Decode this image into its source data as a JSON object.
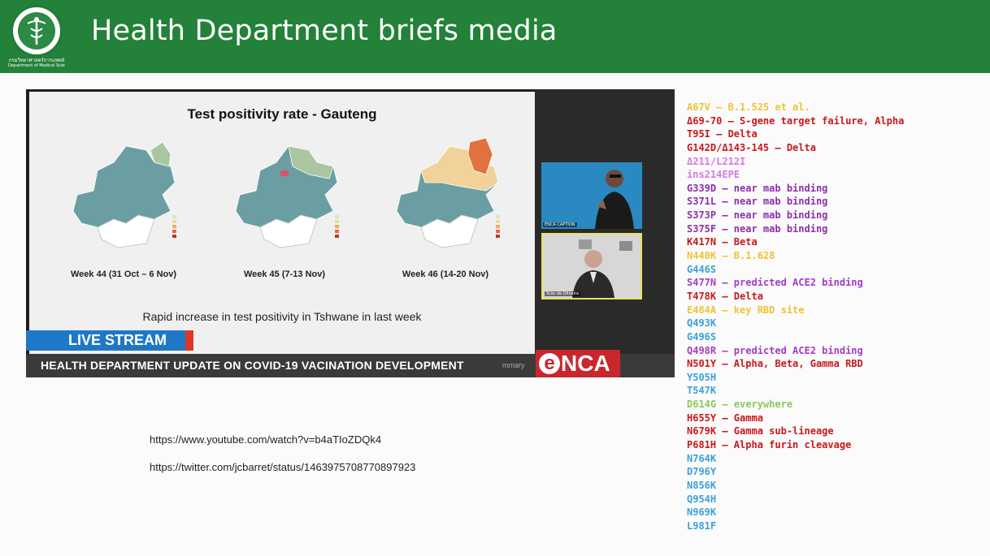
{
  "header": {
    "title": "Health Department briefs media",
    "logo_line1": "กรมวิทยาศาสตร์การแพทย์",
    "logo_line2": "Department of Medical Sciences",
    "bg_color": "#238139"
  },
  "slide": {
    "title": "Test positivity rate - Gauteng",
    "weeks": [
      "Week 44 (31 Oct – 6 Nov)",
      "Week 45 (7-13 Nov)",
      "Week 46 (14-20 Nov)"
    ],
    "caption": "Rapid increase in test positivity in Tshwane in last week"
  },
  "broadcast": {
    "live_label": "LIVE STREAM",
    "ticker": "HEALTH DEPARTMENT UPDATE ON COVID-19 VACINATION DEVELOPMENT",
    "ticker_extra": "mmary",
    "channel_e": "e",
    "channel_rest": "NCA",
    "cam1_label": "ENCA CAPTION",
    "cam2_label": "Tulio de Oliveira"
  },
  "links": [
    "https://www.youtube.com/watch?v=b4aTIoZDQk4",
    "https://twitter.com/jcbarret/status/1463975708770897923"
  ],
  "mutations": [
    {
      "text": "A67V – B.1.525 et al.",
      "color": "#f0c330"
    },
    {
      "text": "Δ69-70 – S-gene target failure, Alpha",
      "color": "#c8181c"
    },
    {
      "text": "T95I – Delta",
      "color": "#c8181c"
    },
    {
      "text": "G142D/Δ143-145 – Delta",
      "color": "#c8181c"
    },
    {
      "text": "Δ211/L212I",
      "color": "#d57ae0"
    },
    {
      "text": "ins214EPE",
      "color": "#d57ae0"
    },
    {
      "text": "G339D – near mab binding",
      "color": "#8a32a8"
    },
    {
      "text": "S371L – near mab binding",
      "color": "#8a32a8"
    },
    {
      "text": "S373P – near mab binding",
      "color": "#8a32a8"
    },
    {
      "text": "S375F – near mab binding",
      "color": "#8a32a8"
    },
    {
      "text": "K417N – Beta",
      "color": "#c8181c"
    },
    {
      "text": "N440K – B.1.628",
      "color": "#f0c330"
    },
    {
      "text": "G446S",
      "color": "#3ca0d8"
    },
    {
      "text": "S477N – predicted ACE2 binding",
      "color": "#a43cc8"
    },
    {
      "text": "T478K – Delta",
      "color": "#c8181c"
    },
    {
      "text": "E484A – key RBD site",
      "color": "#f0c330"
    },
    {
      "text": "Q493K",
      "color": "#3ca0d8"
    },
    {
      "text": "G496S",
      "color": "#3ca0d8"
    },
    {
      "text": "Q498R – predicted ACE2 binding",
      "color": "#a43cc8"
    },
    {
      "text": "N501Y – Alpha, Beta, Gamma RBD",
      "color": "#c8181c"
    },
    {
      "text": "Y505H",
      "color": "#3ca0d8"
    },
    {
      "text": "T547K",
      "color": "#3ca0d8"
    },
    {
      "text": "D614G – everywhere",
      "color": "#8dc858"
    },
    {
      "text": "H655Y – Gamma",
      "color": "#c8181c"
    },
    {
      "text": "N679K – Gamma sub-lineage",
      "color": "#c8181c"
    },
    {
      "text": "P681H – Alpha furin cleavage",
      "color": "#c8181c"
    },
    {
      "text": "N764K",
      "color": "#3ca0d8"
    },
    {
      "text": "D796Y",
      "color": "#3ca0d8"
    },
    {
      "text": "N856K",
      "color": "#3ca0d8"
    },
    {
      "text": "Q954H",
      "color": "#3ca0d8"
    },
    {
      "text": "N969K",
      "color": "#3ca0d8"
    },
    {
      "text": "L981F",
      "color": "#3ca0d8"
    }
  ]
}
